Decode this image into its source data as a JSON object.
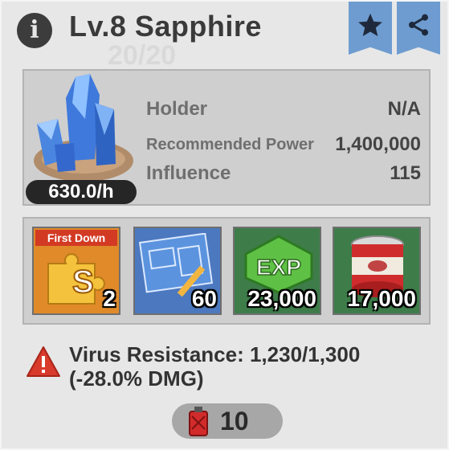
{
  "header": {
    "title": "Lv.8 Sapphire",
    "watermark": "20/20",
    "info_icon": "info-icon",
    "favorite_icon": "star-icon",
    "share_icon": "share-icon",
    "ribbon_color": "#6e9cd0"
  },
  "resource": {
    "rate": "630.0/h",
    "stats": [
      {
        "label": "Holder",
        "value": "N/A"
      },
      {
        "label": "Recommended Power",
        "value": "1,400,000"
      },
      {
        "label": "Influence",
        "value": "115"
      }
    ]
  },
  "rewards": [
    {
      "name": "first-down-puzzle",
      "badge": "First Down",
      "qty": "2"
    },
    {
      "name": "blueprint",
      "qty": "60"
    },
    {
      "name": "exp",
      "icon_text": "EXP",
      "qty": "23,000"
    },
    {
      "name": "canned-food",
      "qty": "17,000"
    }
  ],
  "warning": {
    "icon": "warning-icon",
    "text": "Virus Resistance: 1,230/1,300 (-28.0% DMG)"
  },
  "cost": {
    "icon": "fuel-can-icon",
    "value": "10"
  }
}
